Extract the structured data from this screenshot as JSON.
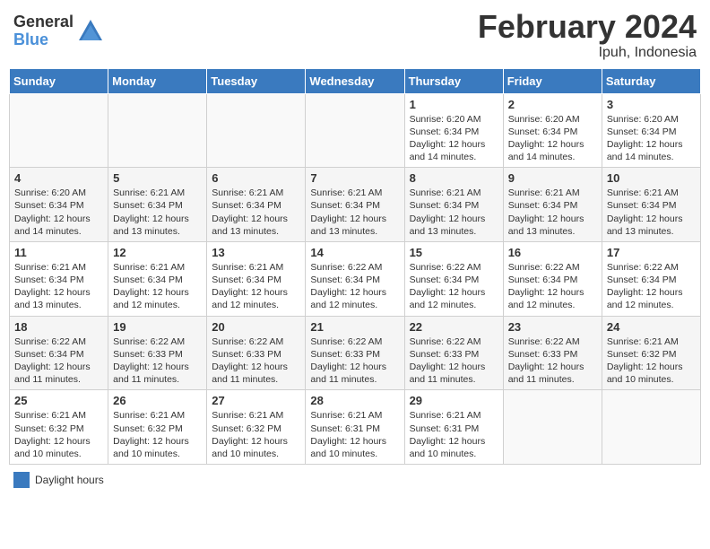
{
  "logo": {
    "general": "General",
    "blue": "Blue"
  },
  "title": {
    "month": "February 2024",
    "location": "Ipuh, Indonesia"
  },
  "days_of_week": [
    "Sunday",
    "Monday",
    "Tuesday",
    "Wednesday",
    "Thursday",
    "Friday",
    "Saturday"
  ],
  "legend": {
    "label": "Daylight hours"
  },
  "weeks": [
    {
      "days": [
        {
          "num": "",
          "info": ""
        },
        {
          "num": "",
          "info": ""
        },
        {
          "num": "",
          "info": ""
        },
        {
          "num": "",
          "info": ""
        },
        {
          "num": "1",
          "info": "Sunrise: 6:20 AM\nSunset: 6:34 PM\nDaylight: 12 hours\nand 14 minutes."
        },
        {
          "num": "2",
          "info": "Sunrise: 6:20 AM\nSunset: 6:34 PM\nDaylight: 12 hours\nand 14 minutes."
        },
        {
          "num": "3",
          "info": "Sunrise: 6:20 AM\nSunset: 6:34 PM\nDaylight: 12 hours\nand 14 minutes."
        }
      ]
    },
    {
      "days": [
        {
          "num": "4",
          "info": "Sunrise: 6:20 AM\nSunset: 6:34 PM\nDaylight: 12 hours\nand 14 minutes."
        },
        {
          "num": "5",
          "info": "Sunrise: 6:21 AM\nSunset: 6:34 PM\nDaylight: 12 hours\nand 13 minutes."
        },
        {
          "num": "6",
          "info": "Sunrise: 6:21 AM\nSunset: 6:34 PM\nDaylight: 12 hours\nand 13 minutes."
        },
        {
          "num": "7",
          "info": "Sunrise: 6:21 AM\nSunset: 6:34 PM\nDaylight: 12 hours\nand 13 minutes."
        },
        {
          "num": "8",
          "info": "Sunrise: 6:21 AM\nSunset: 6:34 PM\nDaylight: 12 hours\nand 13 minutes."
        },
        {
          "num": "9",
          "info": "Sunrise: 6:21 AM\nSunset: 6:34 PM\nDaylight: 12 hours\nand 13 minutes."
        },
        {
          "num": "10",
          "info": "Sunrise: 6:21 AM\nSunset: 6:34 PM\nDaylight: 12 hours\nand 13 minutes."
        }
      ]
    },
    {
      "days": [
        {
          "num": "11",
          "info": "Sunrise: 6:21 AM\nSunset: 6:34 PM\nDaylight: 12 hours\nand 13 minutes."
        },
        {
          "num": "12",
          "info": "Sunrise: 6:21 AM\nSunset: 6:34 PM\nDaylight: 12 hours\nand 12 minutes."
        },
        {
          "num": "13",
          "info": "Sunrise: 6:21 AM\nSunset: 6:34 PM\nDaylight: 12 hours\nand 12 minutes."
        },
        {
          "num": "14",
          "info": "Sunrise: 6:22 AM\nSunset: 6:34 PM\nDaylight: 12 hours\nand 12 minutes."
        },
        {
          "num": "15",
          "info": "Sunrise: 6:22 AM\nSunset: 6:34 PM\nDaylight: 12 hours\nand 12 minutes."
        },
        {
          "num": "16",
          "info": "Sunrise: 6:22 AM\nSunset: 6:34 PM\nDaylight: 12 hours\nand 12 minutes."
        },
        {
          "num": "17",
          "info": "Sunrise: 6:22 AM\nSunset: 6:34 PM\nDaylight: 12 hours\nand 12 minutes."
        }
      ]
    },
    {
      "days": [
        {
          "num": "18",
          "info": "Sunrise: 6:22 AM\nSunset: 6:34 PM\nDaylight: 12 hours\nand 11 minutes."
        },
        {
          "num": "19",
          "info": "Sunrise: 6:22 AM\nSunset: 6:33 PM\nDaylight: 12 hours\nand 11 minutes."
        },
        {
          "num": "20",
          "info": "Sunrise: 6:22 AM\nSunset: 6:33 PM\nDaylight: 12 hours\nand 11 minutes."
        },
        {
          "num": "21",
          "info": "Sunrise: 6:22 AM\nSunset: 6:33 PM\nDaylight: 12 hours\nand 11 minutes."
        },
        {
          "num": "22",
          "info": "Sunrise: 6:22 AM\nSunset: 6:33 PM\nDaylight: 12 hours\nand 11 minutes."
        },
        {
          "num": "23",
          "info": "Sunrise: 6:22 AM\nSunset: 6:33 PM\nDaylight: 12 hours\nand 11 minutes."
        },
        {
          "num": "24",
          "info": "Sunrise: 6:21 AM\nSunset: 6:32 PM\nDaylight: 12 hours\nand 10 minutes."
        }
      ]
    },
    {
      "days": [
        {
          "num": "25",
          "info": "Sunrise: 6:21 AM\nSunset: 6:32 PM\nDaylight: 12 hours\nand 10 minutes."
        },
        {
          "num": "26",
          "info": "Sunrise: 6:21 AM\nSunset: 6:32 PM\nDaylight: 12 hours\nand 10 minutes."
        },
        {
          "num": "27",
          "info": "Sunrise: 6:21 AM\nSunset: 6:32 PM\nDaylight: 12 hours\nand 10 minutes."
        },
        {
          "num": "28",
          "info": "Sunrise: 6:21 AM\nSunset: 6:31 PM\nDaylight: 12 hours\nand 10 minutes."
        },
        {
          "num": "29",
          "info": "Sunrise: 6:21 AM\nSunset: 6:31 PM\nDaylight: 12 hours\nand 10 minutes."
        },
        {
          "num": "",
          "info": ""
        },
        {
          "num": "",
          "info": ""
        }
      ]
    }
  ]
}
